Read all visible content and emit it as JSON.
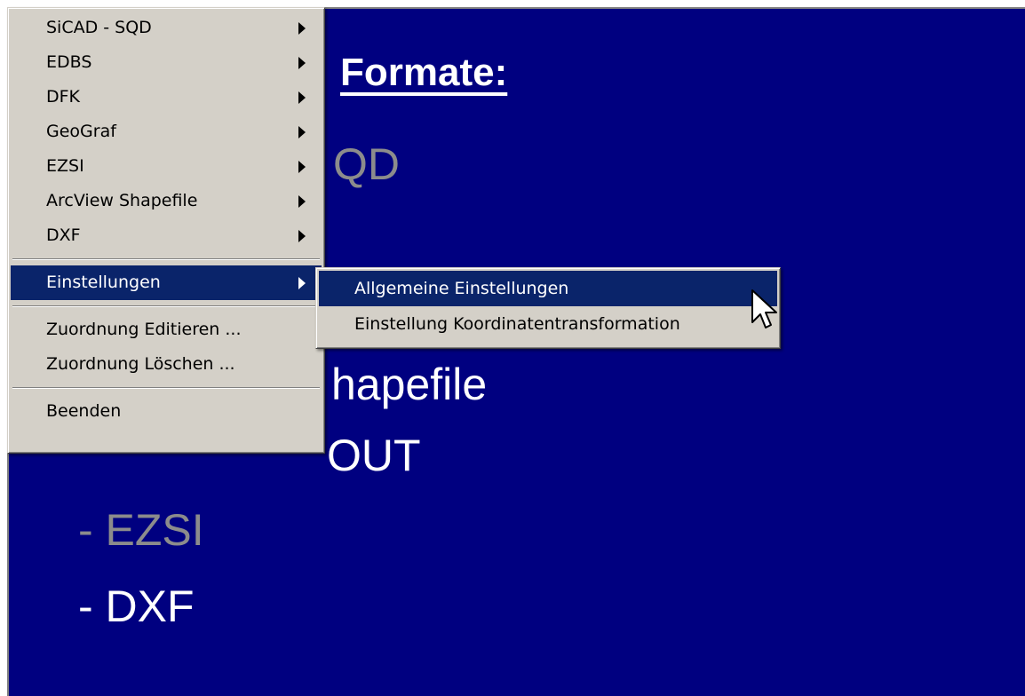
{
  "background": {
    "title": "Formate:",
    "lines": [
      {
        "text": "QD",
        "color": "#8c8c8c"
      },
      {
        "text": "hapefile",
        "color": "#ffffff"
      },
      {
        "text": "OUT",
        "color": "#ffffff"
      },
      {
        "text": "- EZSI",
        "color": "#8c8c8c"
      },
      {
        "text": "- DXF",
        "color": "#ffffff"
      }
    ]
  },
  "main_menu": {
    "items": [
      {
        "label": "SiCAD - SQD",
        "submenu": true
      },
      {
        "label": "EDBS",
        "submenu": true
      },
      {
        "label": "DFK",
        "submenu": true
      },
      {
        "label": "GeoGraf",
        "submenu": true
      },
      {
        "label": "EZSI",
        "submenu": true
      },
      {
        "label": "ArcView Shapefile",
        "submenu": true
      },
      {
        "label": "DXF",
        "submenu": true
      },
      {
        "label": "Einstellungen",
        "submenu": true,
        "highlighted": true
      },
      {
        "label": "Zuordnung Editieren ...",
        "submenu": false
      },
      {
        "label": "Zuordnung Löschen ...",
        "submenu": false
      },
      {
        "label": "Beenden",
        "submenu": false
      }
    ]
  },
  "sub_menu": {
    "items": [
      {
        "label": "Allgemeine Einstellungen",
        "highlighted": true
      },
      {
        "label": "Einstellung Koordinatentransformation",
        "highlighted": false
      }
    ]
  },
  "colors": {
    "background_blue": "#000080",
    "menu_face": "#d4d0c8",
    "highlight": "#0a246a"
  }
}
